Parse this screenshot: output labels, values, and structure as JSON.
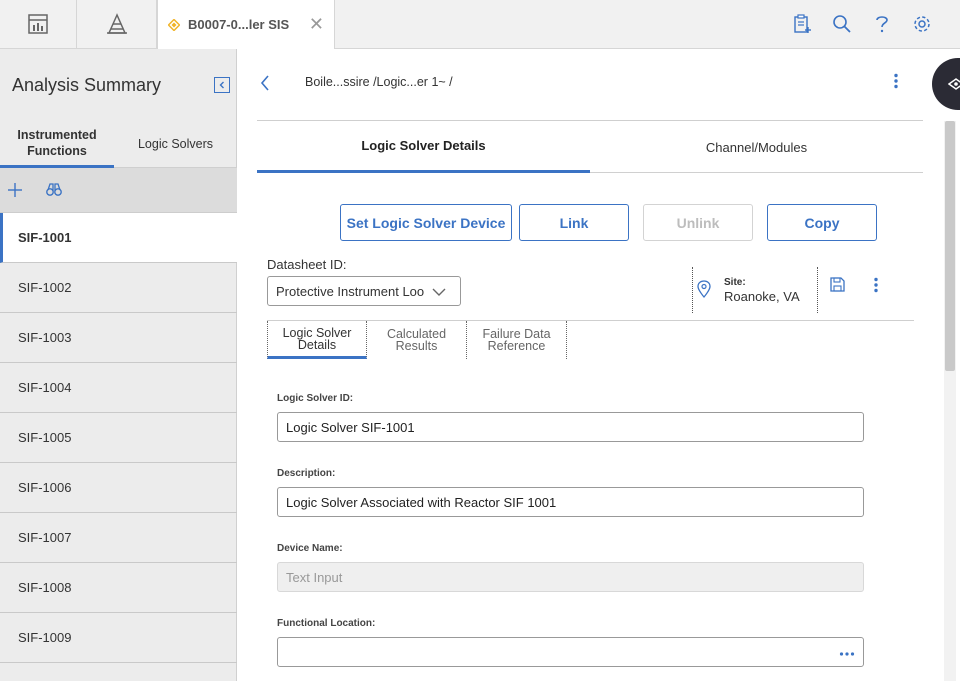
{
  "topbar": {
    "tab_title": "B0007-0...ler SIS",
    "tab_close": "✕",
    "icons": [
      "dashboard-icon",
      "hierarchy-icon",
      "clipboard-add-icon",
      "search-icon",
      "help-icon",
      "settings-icon"
    ]
  },
  "sidebar": {
    "title": "Analysis Summary",
    "tabs": [
      {
        "label": "Instrumented Functions"
      },
      {
        "label": "Logic Solvers"
      }
    ],
    "items": [
      {
        "label": "SIF-1001",
        "selected": true
      },
      {
        "label": "SIF-1002"
      },
      {
        "label": "SIF-1003"
      },
      {
        "label": "SIF-1004"
      },
      {
        "label": "SIF-1005"
      },
      {
        "label": "SIF-1006"
      },
      {
        "label": "SIF-1007"
      },
      {
        "label": "SIF-1008"
      },
      {
        "label": "SIF-1009"
      }
    ]
  },
  "main": {
    "breadcrumb": "Boile...ssire /Logic...er 1~ /",
    "tabs": [
      {
        "label": "Logic Solver Details"
      },
      {
        "label": "Channel/Modules"
      }
    ],
    "actions": {
      "set_device": "Set Logic Solver Device",
      "link": "Link",
      "unlink": "Unlink",
      "copy": "Copy"
    },
    "datasheet": {
      "label": "Datasheet ID:",
      "value": "Protective Instrument Loo"
    },
    "site": {
      "label": "Site:",
      "value": "Roanoke, VA"
    },
    "subtabs": [
      {
        "label": "Logic Solver Details"
      },
      {
        "label": "Calculated Results"
      },
      {
        "label": "Failure Data Reference"
      }
    ],
    "fields": {
      "logic_solver_id": {
        "label": "Logic Solver ID:",
        "value": "Logic Solver SIF-1001"
      },
      "description": {
        "label": "Description:",
        "value": "Logic Solver Associated with Reactor SIF 1001"
      },
      "device_name": {
        "label": "Device Name:",
        "placeholder": "Text Input"
      },
      "functional_location": {
        "label": "Functional Location:",
        "value": ""
      }
    }
  },
  "colors": {
    "accent": "#3b73c4",
    "disabled": "#bdbdbd",
    "rail": "#2b2b35"
  }
}
